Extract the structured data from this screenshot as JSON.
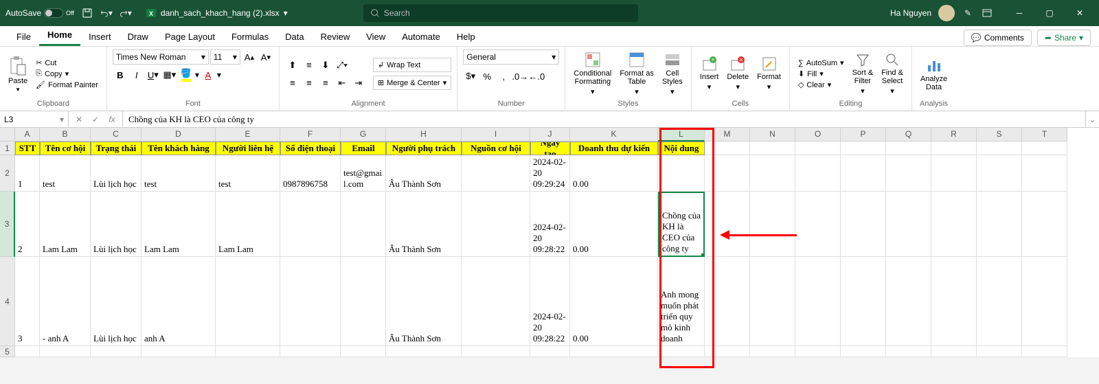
{
  "titlebar": {
    "autosave": "AutoSave",
    "autosave_state": "Off",
    "filename": "danh_sach_khach_hang (2).xlsx",
    "search_placeholder": "Search",
    "username": "Ha Nguyen"
  },
  "tabs": [
    "File",
    "Home",
    "Insert",
    "Draw",
    "Page Layout",
    "Formulas",
    "Data",
    "Review",
    "View",
    "Automate",
    "Help"
  ],
  "active_tab": 1,
  "right_buttons": {
    "comments": "Comments",
    "share": "Share"
  },
  "ribbon": {
    "clipboard": {
      "paste": "Paste",
      "cut": "Cut",
      "copy": "Copy",
      "fp": "Format Painter",
      "label": "Clipboard"
    },
    "font": {
      "name": "Times New Roman",
      "size": "11",
      "label": "Font"
    },
    "alignment": {
      "wrap": "Wrap Text",
      "merge": "Merge & Center",
      "label": "Alignment"
    },
    "number": {
      "format": "General",
      "label": "Number"
    },
    "styles": {
      "cf": "Conditional\nFormatting",
      "fat": "Format as\nTable",
      "cs": "Cell\nStyles",
      "label": "Styles"
    },
    "cells": {
      "ins": "Insert",
      "del": "Delete",
      "fmt": "Format",
      "label": "Cells"
    },
    "editing": {
      "sum": "AutoSum",
      "fill": "Fill",
      "clear": "Clear",
      "sort": "Sort &\nFilter",
      "find": "Find &\nSelect",
      "label": "Editing"
    },
    "analysis": {
      "analyze": "Analyze\nData",
      "label": "Analysis"
    }
  },
  "formula": {
    "namebox": "L3",
    "content": "Chồng của KH là CEO của công ty"
  },
  "columns": [
    "A",
    "B",
    "C",
    "D",
    "E",
    "F",
    "G",
    "H",
    "I",
    "J",
    "K",
    "L",
    "M",
    "N",
    "O",
    "P",
    "Q",
    "R",
    "S",
    "T"
  ],
  "active_col": 11,
  "headers": [
    "STT",
    "Tên cơ hội",
    "Trạng thái",
    "Tên khách hàng",
    "Người liên hệ",
    "Số điện thoại",
    "Email",
    "Người phụ trách",
    "Nguồn cơ hội",
    "Ngày tạo",
    "Doanh thu dự kiến",
    "Nội dung"
  ],
  "rows": [
    {
      "n": 2,
      "data": [
        "1",
        "test",
        "Lùi lịch học",
        "test",
        "test",
        "0987896758",
        "test@gmail.com",
        "Âu Thành Sơn",
        "",
        "2024-02-20 09:29:24",
        "0.00",
        ""
      ]
    },
    {
      "n": 3,
      "data": [
        "2",
        "Lam Lam",
        "Lùi lịch học",
        "Lam Lam",
        "Lam Lam",
        "",
        "",
        "Âu Thành Sơn",
        "",
        "2024-02-20 09:28:22",
        "0.00",
        "Chồng của KH là CEO của công ty"
      ]
    },
    {
      "n": 4,
      "data": [
        "3",
        "- anh A",
        "Lùi lịch học",
        "anh A",
        "",
        "",
        "",
        "Âu Thành Sơn",
        "",
        "2024-02-20 09:28:22",
        "0.00",
        "Anh mong muốn phát triển quy mô kinh doanh"
      ]
    }
  ],
  "chart_data": null
}
